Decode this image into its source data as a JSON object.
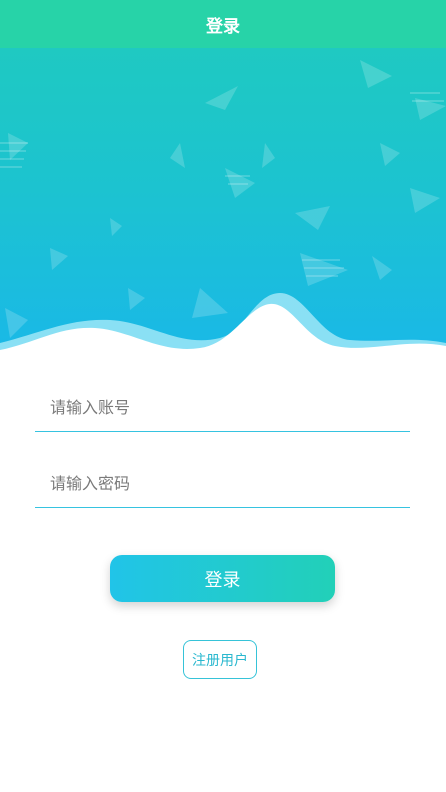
{
  "header": {
    "title": "登录"
  },
  "form": {
    "account_placeholder": "请输入账号",
    "password_placeholder": "请输入密码",
    "account_value": "",
    "password_value": ""
  },
  "actions": {
    "login_label": "登录",
    "register_label": "注册用户"
  },
  "colors": {
    "header_bg": "#27d3a8",
    "accent": "#1ab8e8",
    "input_underline": "#36c3e0"
  }
}
